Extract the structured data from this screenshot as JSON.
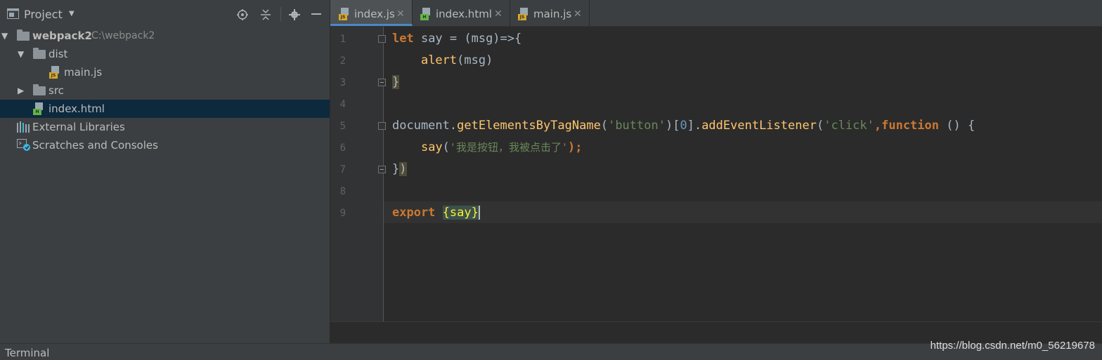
{
  "project_panel": {
    "title": "Project",
    "tree": [
      {
        "label": "webpack2",
        "path": "C:\\webpack2"
      },
      {
        "label": "dist"
      },
      {
        "label": "main.js",
        "file_tag": "JS"
      },
      {
        "label": "src"
      },
      {
        "label": "index.html",
        "file_tag": "H"
      },
      {
        "label": "External Libraries"
      },
      {
        "label": "Scratches and Consoles"
      }
    ]
  },
  "tabs": [
    {
      "label": "index.js",
      "file_tag": "JS",
      "active": true
    },
    {
      "label": "index.html",
      "file_tag": "H"
    },
    {
      "label": "main.js",
      "file_tag": "JS"
    }
  ],
  "editor": {
    "line_numbers": [
      "1",
      "2",
      "3",
      "4",
      "5",
      "6",
      "7",
      "8",
      "9"
    ],
    "lines": [
      "let say = (msg)=>{",
      "    alert(msg)",
      "}",
      "",
      "document.getElementsByTagName('button')[0].addEventListener('click',function () {",
      "    say('我是按钮，我被点击了');",
      "})",
      "",
      "export {say}"
    ],
    "tokens": {
      "l1_kw": "let",
      "l1_rest": " say = (msg)=>{",
      "l2_indent": "    ",
      "l2_fn": "alert",
      "l2_rest": "(msg)",
      "l3": "}",
      "l5_obj": "document.",
      "l5_fn1": "getElementsByTagName",
      "l5_p1": "(",
      "l5_s1": "'button'",
      "l5_p2": ")[",
      "l5_n": "0",
      "l5_p3": "].",
      "l5_fn2": "addEventListener",
      "l5_p4": "(",
      "l5_s2": "'click'",
      "l5_p5": ",",
      "l5_kw": "function",
      "l5_rest": " () {",
      "l6_indent": "    ",
      "l6_fn": "say",
      "l6_p1": "(",
      "l6_s": "'我是按钮，我被点击了'",
      "l6_p2": ");",
      "l7_a": "}",
      "l7_b": ")",
      "l9_kw": "export",
      "l9_sp": " ",
      "l9_brace": "{say}"
    }
  },
  "bottom_bar": {
    "terminal_label": "Terminal",
    "watermark": "https://blog.csdn.net/m0_56219678"
  },
  "colors": {
    "keyword": "#cc7832",
    "function": "#ffc66d",
    "string": "#6a8759",
    "number": "#6897bb",
    "selection": "#0d293e",
    "active_tab_underline": "#4a88c7"
  }
}
